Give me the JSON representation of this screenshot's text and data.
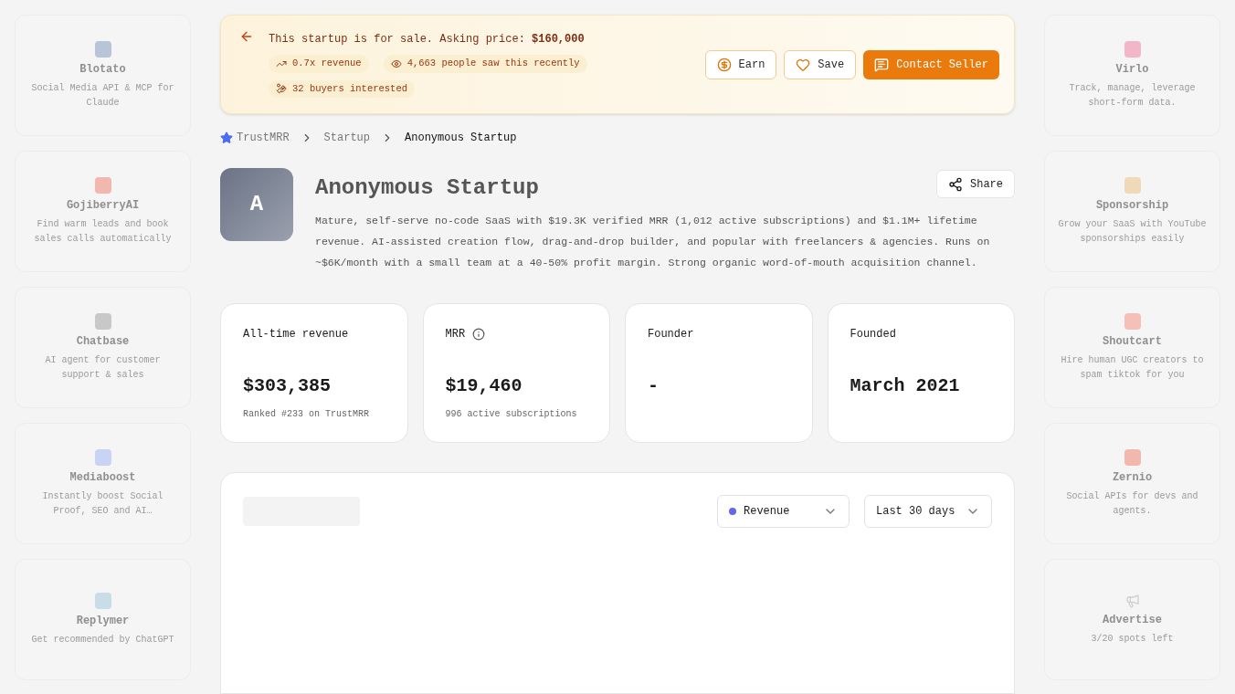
{
  "left_ads": [
    {
      "name": "Blotato",
      "tagline": "Social Media API & MCP for Claude",
      "color": "#b8c4d8"
    },
    {
      "name": "GojiberryAI",
      "tagline": "Find warm leads and book sales calls automatically",
      "color": "#f2b8b0"
    },
    {
      "name": "Chatbase",
      "tagline": "AI agent for customer support & sales",
      "color": "#c8c8c8"
    },
    {
      "name": "Mediaboost",
      "tagline": "Instantly boost Social Proof, SEO and AI…",
      "color": "#c9d3f3"
    },
    {
      "name": "Replymer",
      "tagline": "Get recommended by ChatGPT",
      "color": "#c8dde6"
    }
  ],
  "right_ads": [
    {
      "name": "Virlo",
      "tagline": "Track, manage, leverage short-form data.",
      "color": "#f2b6c8"
    },
    {
      "name": "Sponsorship",
      "tagline": "Grow your SaaS with YouTube sponsorships easily",
      "color": "#f0d9b8"
    },
    {
      "name": "Shoutcart",
      "tagline": "Hire human UGC creators to spam tiktok for you",
      "color": "#f5c0b8"
    },
    {
      "name": "Zernio",
      "tagline": "Social APIs for devs and agents.",
      "color": "#f2b8ae"
    },
    {
      "name": "Advertise",
      "tagline": "3/20 spots left",
      "color": "#cfcfcf"
    }
  ],
  "sale_banner": {
    "text": "This startup is for sale. Asking price: **$160,000**",
    "chips": [
      "0.7x revenue",
      "4,663 people saw this recently",
      "32 buyers interested"
    ],
    "buttons": [
      "Earn",
      "Save",
      "Contact Seller"
    ]
  },
  "breadcrumb": [
    "TrustMRR",
    "Startup",
    "Anonymous Startup"
  ],
  "startup": {
    "initial": "A",
    "name": "Anonymous Startup",
    "description": "Mature, self-serve no-code SaaS with $19.3K verified MRR (1,012 active subscriptions) and $1.1M+ lifetime revenue. AI-assisted creation flow, drag-and-drop builder, and popular with freelancers & agencies. Runs on ~$6K/month with a small team at a 40-50% profit margin. Strong organic word-of-mouth acquisition channel.",
    "share": "Share"
  },
  "stats": [
    {
      "label": "All-time revenue",
      "value": "$303,385",
      "note": "Ranked #233 on TrustMRR",
      "info": false
    },
    {
      "label": "MRR",
      "value": "$19,460",
      "note": "996 active subscriptions",
      "info": true
    },
    {
      "label": "Founder",
      "value": "-",
      "info": false
    },
    {
      "label": "Founded",
      "value": "March 2021",
      "info": false
    }
  ],
  "chart_panel": {
    "metric": {
      "label": "Revenue",
      "color": "#6366f1"
    },
    "range": "Last 30 days"
  }
}
